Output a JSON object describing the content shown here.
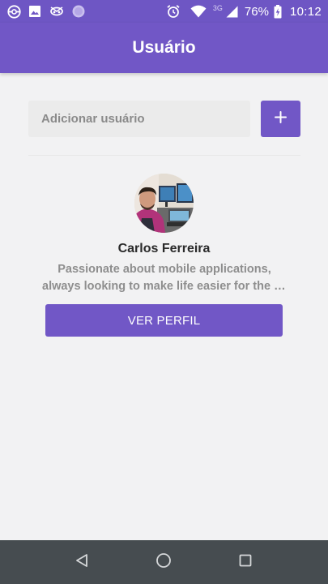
{
  "status_bar": {
    "network": "3G",
    "battery": "76%",
    "time": "10:12"
  },
  "header": {
    "title": "Usuário"
  },
  "add_user": {
    "placeholder": "Adicionar usuário",
    "value": "",
    "button_icon": "plus-icon"
  },
  "user": {
    "name": "Carlos Ferreira",
    "bio_line1": "Passionate about mobile applications,",
    "bio_line2": "always looking to make life easier for the u...",
    "button_label": "VER PERFIL"
  },
  "colors": {
    "primary": "#7157c6",
    "status_bar": "#6e56c4",
    "background": "#f2f2f3",
    "nav_bar": "#464c50"
  }
}
